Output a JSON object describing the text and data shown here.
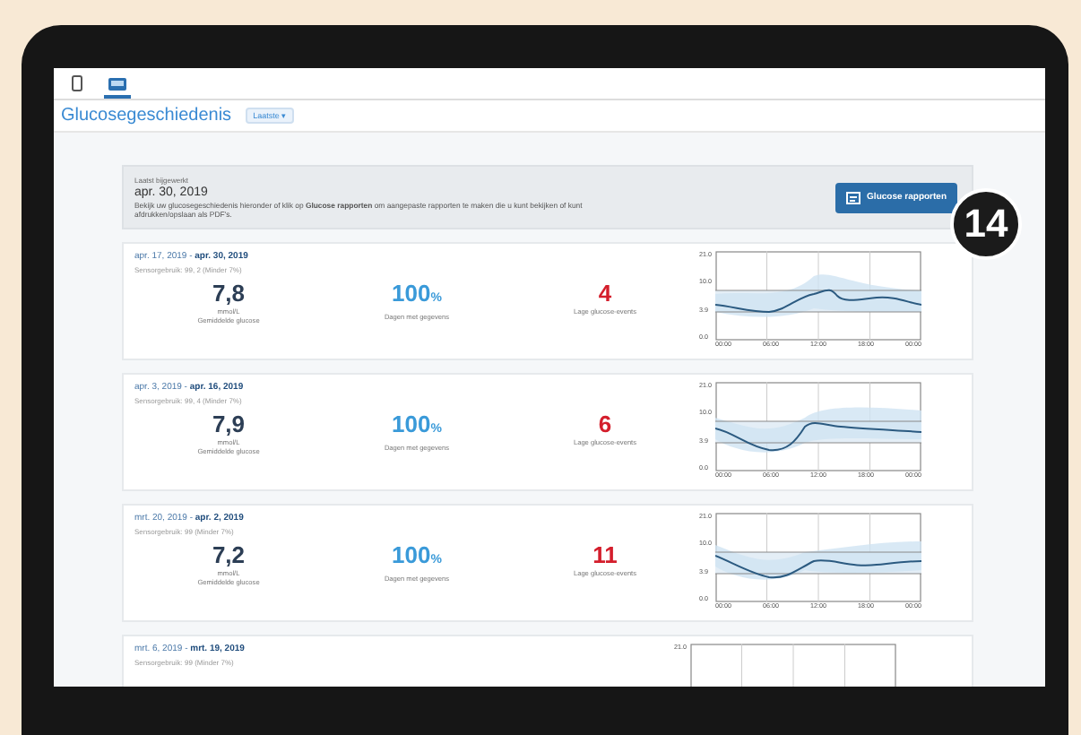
{
  "header": {
    "tabs": [
      {
        "kind": "phone",
        "selected": false
      },
      {
        "kind": "tablet",
        "selected": true
      }
    ],
    "title": "Glucosegeschiedenis",
    "dropdown": "Laatste ▾"
  },
  "info": {
    "label": "Laatst bijgewerkt",
    "date": "apr. 30, 2019",
    "text": "Bekijk uw glucosegeschiedenis hieronder of klik op **Glucose rapporten** om aangepaste rapporten te maken die u kunt bekijken of kunt afdrukken/opslaan als PDF's.",
    "button": "Glucose rapporten"
  },
  "callout": "14",
  "cards": [
    {
      "range": "apr. 17, 2019 - **apr. 30, 2019**",
      "sensor": "Sensorgebruik: 99, 2 (Minder 7%)",
      "average": "7,8",
      "unit": "mmol/L",
      "average_label": "Gemiddelde glucose",
      "days": "100",
      "days_unit": "%",
      "days_label": "Dagen met gegevens",
      "events": "4",
      "events_label": "Lage glucose-events",
      "y_ticks": [
        "21.0",
        "10.0",
        "3.9",
        "0.0"
      ],
      "x_ticks": [
        "00:00",
        "06:00",
        "12:00",
        "18:00",
        "00:00"
      ]
    },
    {
      "range": "apr. 3, 2019 - **apr. 16, 2019**",
      "sensor": "Sensorgebruik: 99, 4 (Minder 7%)",
      "average": "7,9",
      "unit": "mmol/L",
      "average_label": "Gemiddelde glucose",
      "days": "100",
      "days_unit": "%",
      "days_label": "Dagen met gegevens",
      "events": "6",
      "events_label": "Lage glucose-events",
      "y_ticks": [
        "21.0",
        "10.0",
        "3.9",
        "0.0"
      ],
      "x_ticks": [
        "00:00",
        "06:00",
        "12:00",
        "18:00",
        "00:00"
      ]
    },
    {
      "range": "mrt. 20, 2019 - **apr. 2, 2019**",
      "sensor": "Sensorgebruik: 99 (Minder 7%)",
      "average": "7,2",
      "unit": "mmol/L",
      "average_label": "Gemiddelde glucose",
      "days": "100",
      "days_unit": "%",
      "days_label": "Dagen met gegevens",
      "events": "11",
      "events_label": "Lage glucose-events",
      "y_ticks": [
        "21.0",
        "10.0",
        "3.9",
        "0.0"
      ],
      "x_ticks": [
        "00:00",
        "06:00",
        "12:00",
        "18:00",
        "00:00"
      ]
    },
    {
      "range": "mrt. 6, 2019 - **mrt. 19, 2019**",
      "sensor": "Sensorgebruik: 99 (Minder 7%)",
      "y_ticks": [
        "21.0"
      ]
    }
  ]
}
